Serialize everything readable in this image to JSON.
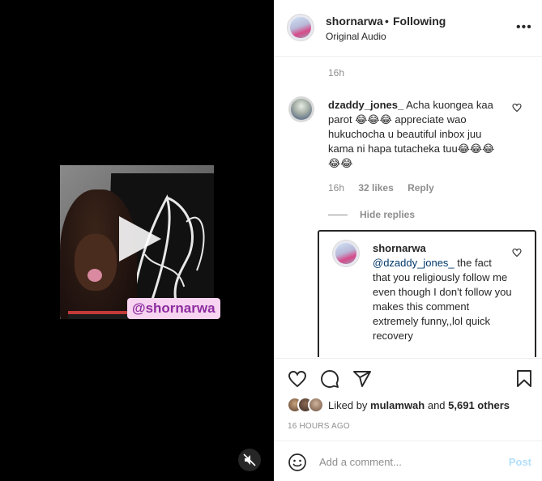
{
  "header": {
    "username": "shornarwa",
    "separator": "•",
    "follow_status": "Following",
    "audio": "Original Audio",
    "more_label": "•••"
  },
  "media": {
    "overlay_tag": "@shornarwa"
  },
  "comments": {
    "caption_time": "16h",
    "items": [
      {
        "username": "dzaddy_jones_",
        "text": "Acha kuongea kaa parot 😂😂😂 appreciate wao hukuchocha u beautiful inbox juu kama ni hapa tutacheka tuu😂😂😂😂😂",
        "time": "16h",
        "likes": "32 likes",
        "reply_label": "Reply",
        "hide_replies_label": "Hide replies",
        "replies": [
          {
            "username": "shornarwa",
            "mention": "@dzaddy_jones_",
            "text": " the fact that you religiously follow me even though I don't follow you makes this comment extremely funny,,lol quick recovery"
          }
        ]
      }
    ]
  },
  "likes": {
    "prefix": "Liked by ",
    "first_user": "mulamwah",
    "and": " and ",
    "others": "5,691 others"
  },
  "posted_ago": "16 HOURS AGO",
  "composer": {
    "placeholder": "Add a comment...",
    "post_label": "Post"
  },
  "colors": {
    "link": "#00376b",
    "muted": "#8e8e8e",
    "post_disabled": "#b2dffc",
    "tag_bg": "#f7d4f0",
    "tag_text": "#8e2da0"
  }
}
